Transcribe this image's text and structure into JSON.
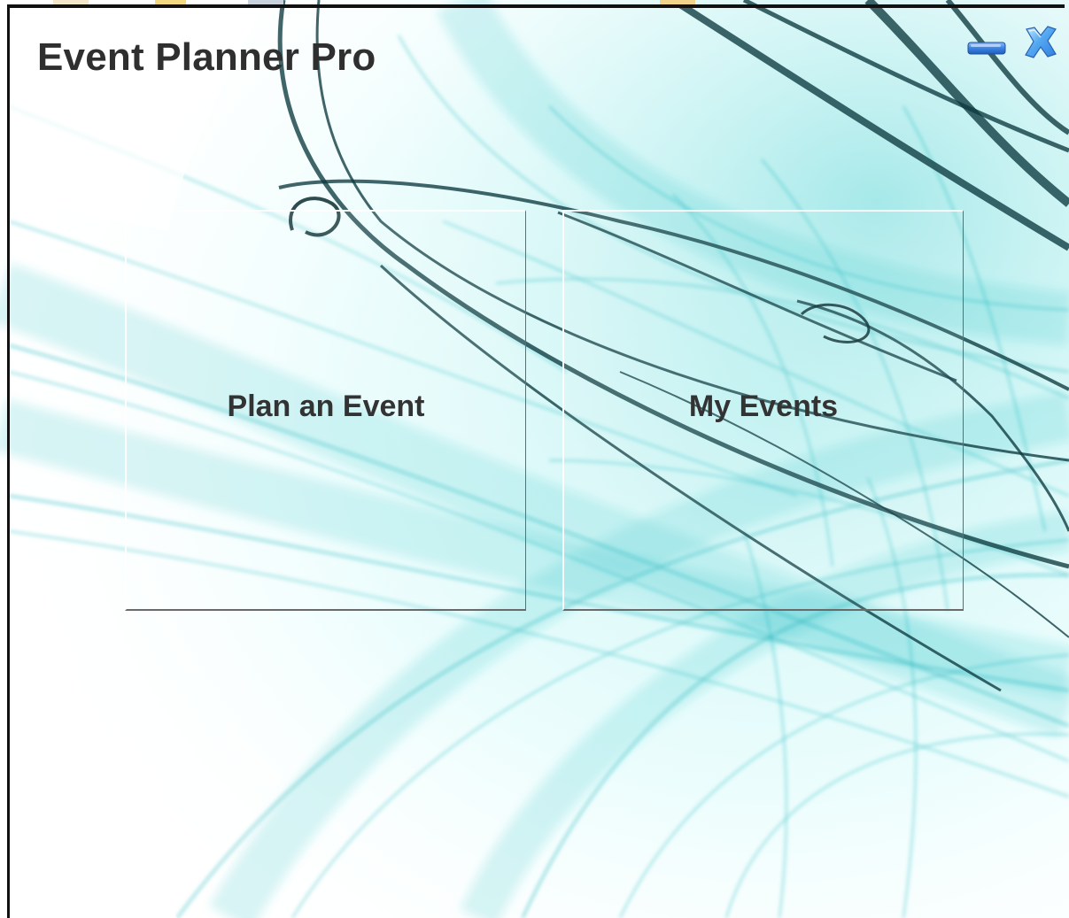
{
  "window": {
    "title": "Event Planner Pro"
  },
  "controls": {
    "minimize_icon": "minimize-icon",
    "close_icon": "close-icon",
    "icon_color": "#2f7fd8"
  },
  "tiles": [
    {
      "label": "Plan an Event"
    },
    {
      "label": "My Events"
    }
  ],
  "theme": {
    "accent": "#16b3b8",
    "dark_accent": "#0b2f33",
    "text": "#333333"
  }
}
